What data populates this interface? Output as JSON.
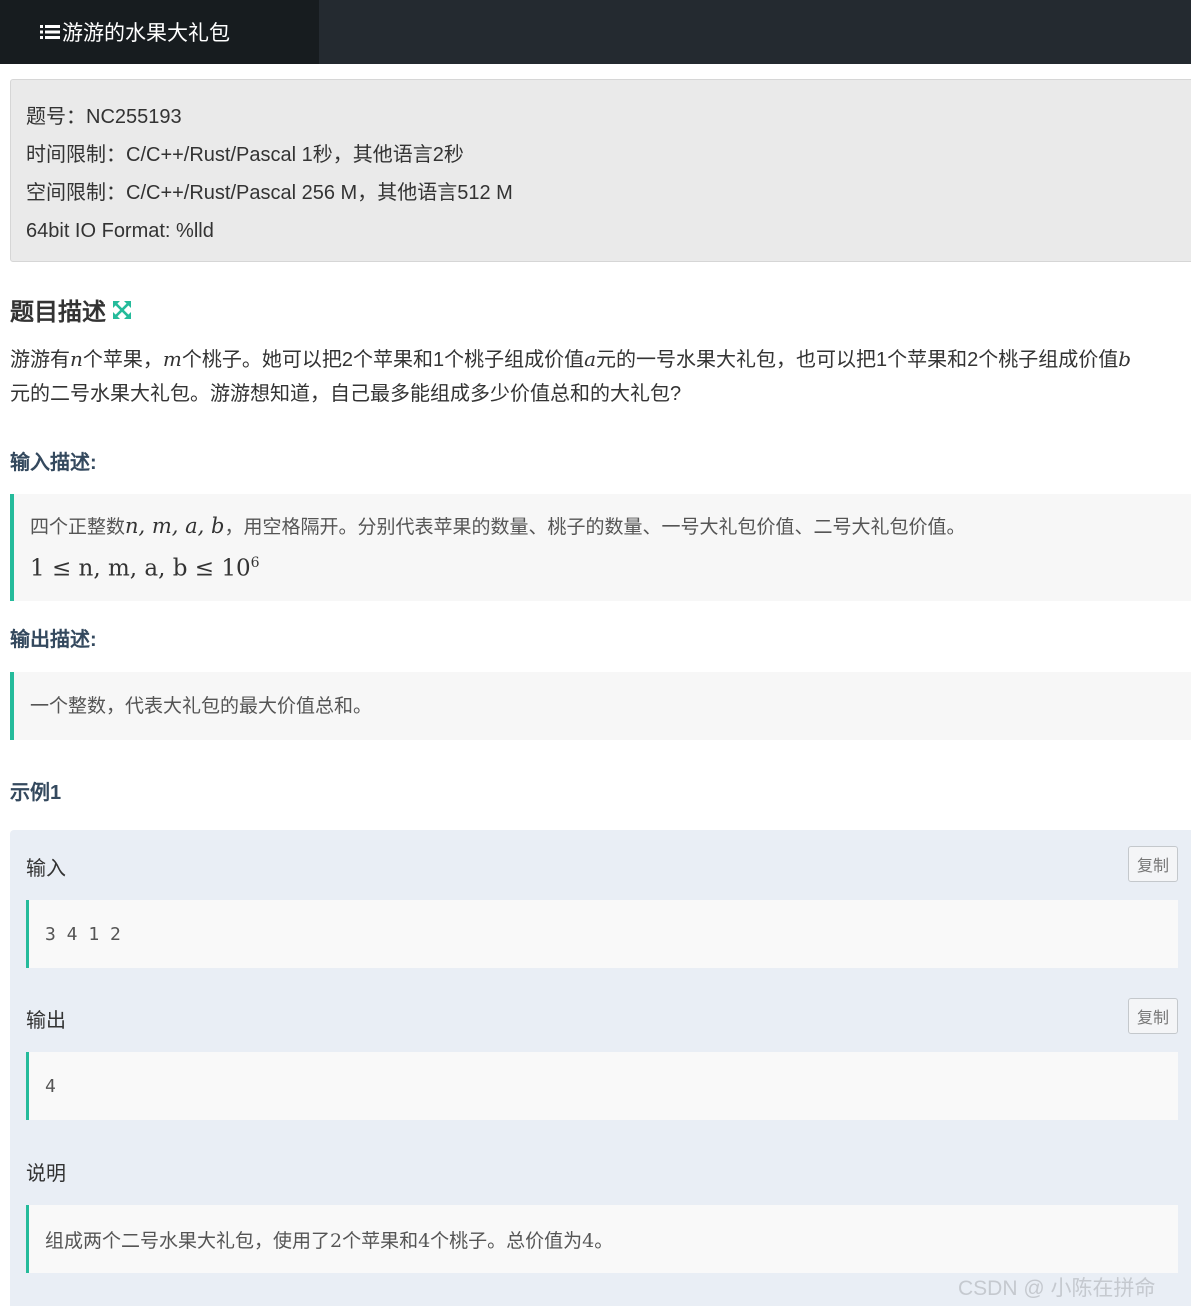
{
  "header": {
    "title": "游游的水果大礼包",
    "title_icon": "list-icon"
  },
  "meta": {
    "problem_id": "题号：NC255193",
    "time_limit": "时间限制：C/C++/Rust/Pascal 1秒，其他语言2秒",
    "memory_limit": "空间限制：C/C++/Rust/Pascal 256 M，其他语言512 M",
    "io_format": "64bit IO Format: %lld"
  },
  "description": {
    "heading": "题目描述",
    "heading_icon": "expand-icon",
    "p1_a": "游游有",
    "n": "n",
    "p1_b": "个苹果，",
    "m": "m",
    "p1_c": "个桃子。她可以把2个苹果和1个桃子组成价值",
    "a": "a",
    "p1_d": "元的一号水果大礼包，也可以把1个苹果和2个桃子组成价值",
    "b": "b",
    "p2": "元的二号水果大礼包。游游想知道，自己最多能组成多少价值总和的大礼包?"
  },
  "input_desc": {
    "heading": "输入描述:",
    "text_a": "四个正整数",
    "vars": "n, m, a, b",
    "text_b": "，用空格隔开。分别代表苹果的数量、桃子的数量、一号大礼包价值、二号大礼包价值。",
    "constraint_lhs": "1 ≤ n, m, a, b ≤ 10",
    "constraint_exp": "6"
  },
  "output_desc": {
    "heading": "输出描述:",
    "text": "一个整数，代表大礼包的最大价值总和。"
  },
  "example": {
    "heading": "示例1",
    "input_label": "输入",
    "input_value": "3 4 1 2",
    "output_label": "输出",
    "output_value": "4",
    "explain_label": "说明",
    "explain_text": "组成两个二号水果大礼包，使用了2个苹果和4个桃子。总价值为4。",
    "copy_label": "复制"
  },
  "watermark": "CSDN @ 小陈在拼命",
  "colors": {
    "accent": "#25bb9b",
    "topbar": "#242a30",
    "title_tab": "#171c1f",
    "example_bg": "#e9eef5"
  }
}
